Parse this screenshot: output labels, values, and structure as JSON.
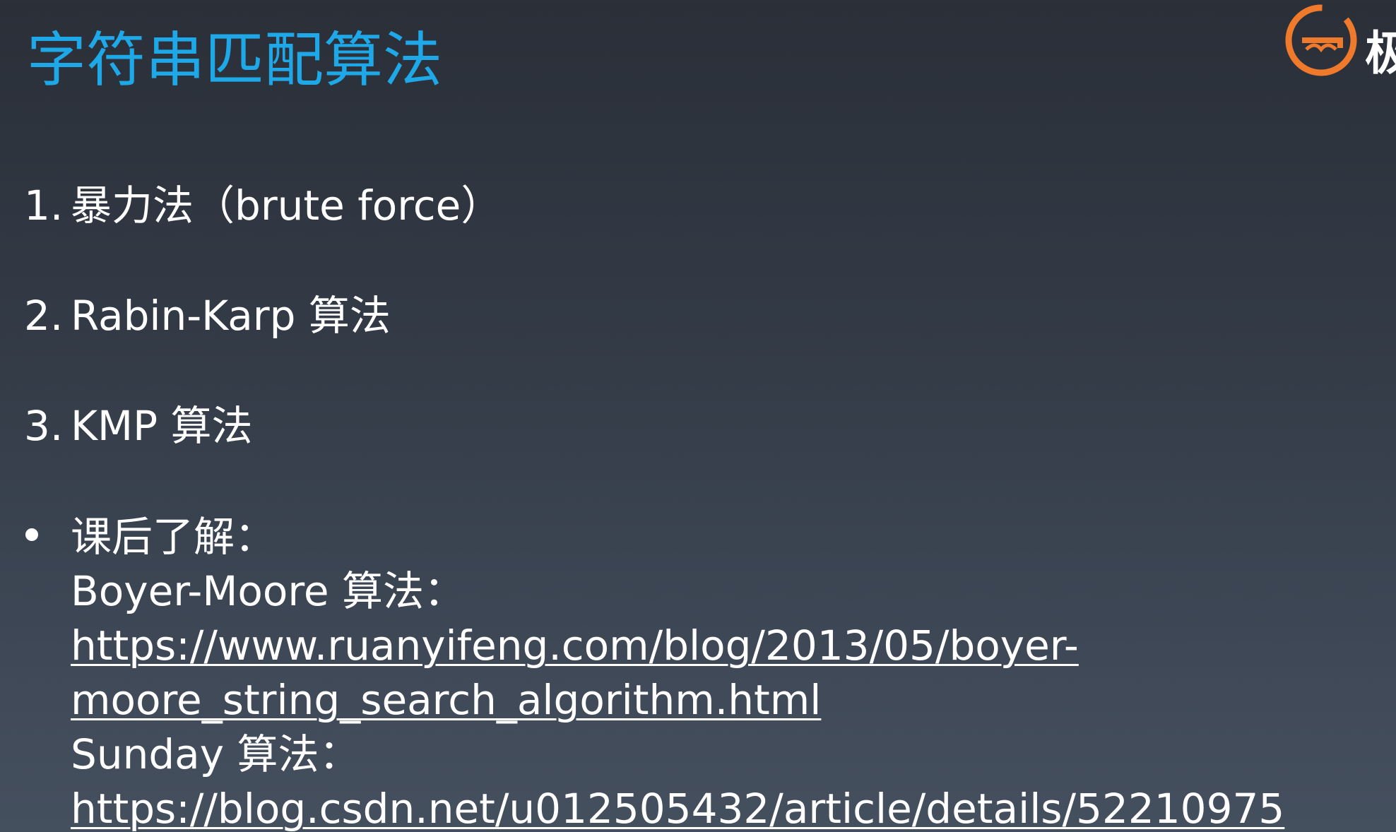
{
  "title": "字符串匹配算法",
  "logo": {
    "icon": "geek-university-logo",
    "char": "极",
    "color": "#f07a2c"
  },
  "items": [
    {
      "num": "1.",
      "text": "暴力法（brute force）"
    },
    {
      "num": "2.",
      "text": "Rabin-Karp 算法"
    },
    {
      "num": "3.",
      "text": "KMP 算法"
    }
  ],
  "extra": {
    "heading": "课后了解：",
    "boyer_label": "Boyer-Moore 算法：",
    "boyer_link_1": "https://www.ruanyifeng.com/blog/2013/05/boyer-",
    "boyer_link_2": "moore_string_search_algorithm.html",
    "sunday_label": "Sunday 算法：",
    "sunday_link": "https://blog.csdn.net/u012505432/article/details/52210975"
  },
  "colors": {
    "title": "#1ea8e8",
    "text": "#ffffff"
  }
}
